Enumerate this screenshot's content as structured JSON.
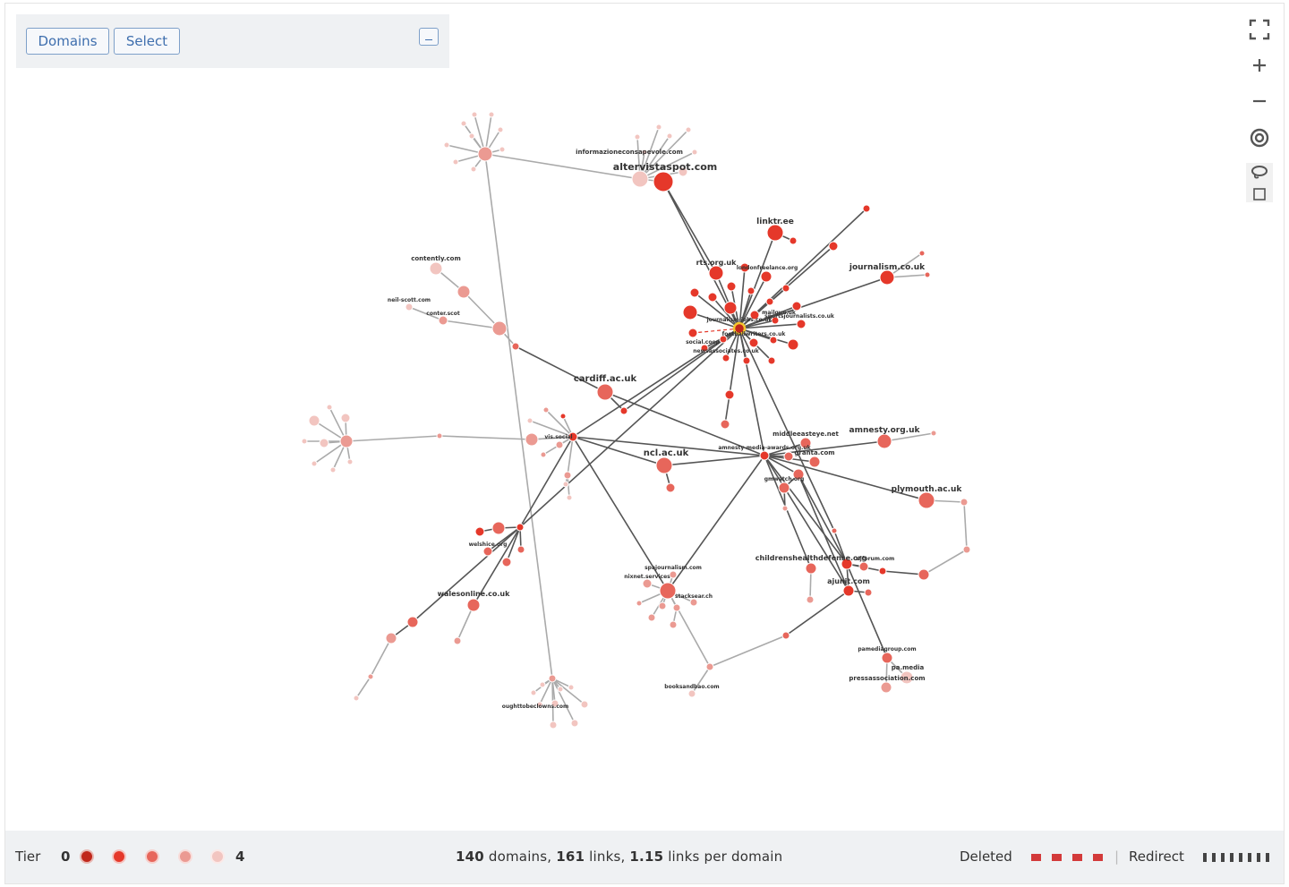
{
  "toolbar": {
    "domains_label": "Domains",
    "select_label": "Select"
  },
  "controls": [
    "fullscreen-icon",
    "zoom-in-icon",
    "zoom-out-icon",
    "target-icon",
    "lasso-icon"
  ],
  "graph": {
    "colors": {
      "tier0": "#c0271b",
      "tier1": "#e5382a",
      "tier2": "#e7665b",
      "tier3": "#eb9a92",
      "tier4": "#f2c5c0",
      "dark_link": "#555555",
      "light_link": "#aaaaaa",
      "highlight": "#f6c62e"
    },
    "labels": [
      "altervistaspot.com",
      "informazioneconsapevole.com",
      "linktr.ee",
      "rts.org.uk",
      "londonfreelance.org",
      "journalism.co.uk",
      "contently.com",
      "neil-scott.com",
      "conter.scot",
      "sportsjournalists.co.uk",
      "mailgun.uk",
      "journalism-jobs.co.uk",
      "footballwriters.co.uk",
      "social.coop",
      "newsassociates.co.uk",
      "cardiff.ac.uk",
      "ncl.ac.uk",
      "middleeasteye.net",
      "amnesty.org.uk",
      "amnesty-media-awards.org.uk",
      "granta.com",
      "gmwatch.org",
      "plymouth.ac.uk",
      "vis.social",
      "welshice.org",
      "walesonline.co.uk",
      "spajournalism.com",
      "nixnet.services",
      "stacksear.ch",
      "childrenshealthdefense.org",
      "ajforum.com",
      "ajunit.com",
      "pamediagroup.com",
      "pa.media",
      "pressassociation.com",
      "booksandbao.com",
      "oughttobeclowns.com"
    ]
  },
  "legend": {
    "tier_label": "Tier",
    "tier_min": "0",
    "tier_max": "4",
    "domain_count": "140",
    "domains_word": "domains,",
    "link_count": "161",
    "links_word": "links,",
    "ratio": "1.15",
    "ratio_word": "links per domain",
    "deleted_label": "Deleted",
    "separator": "|",
    "redirect_label": "Redirect"
  }
}
